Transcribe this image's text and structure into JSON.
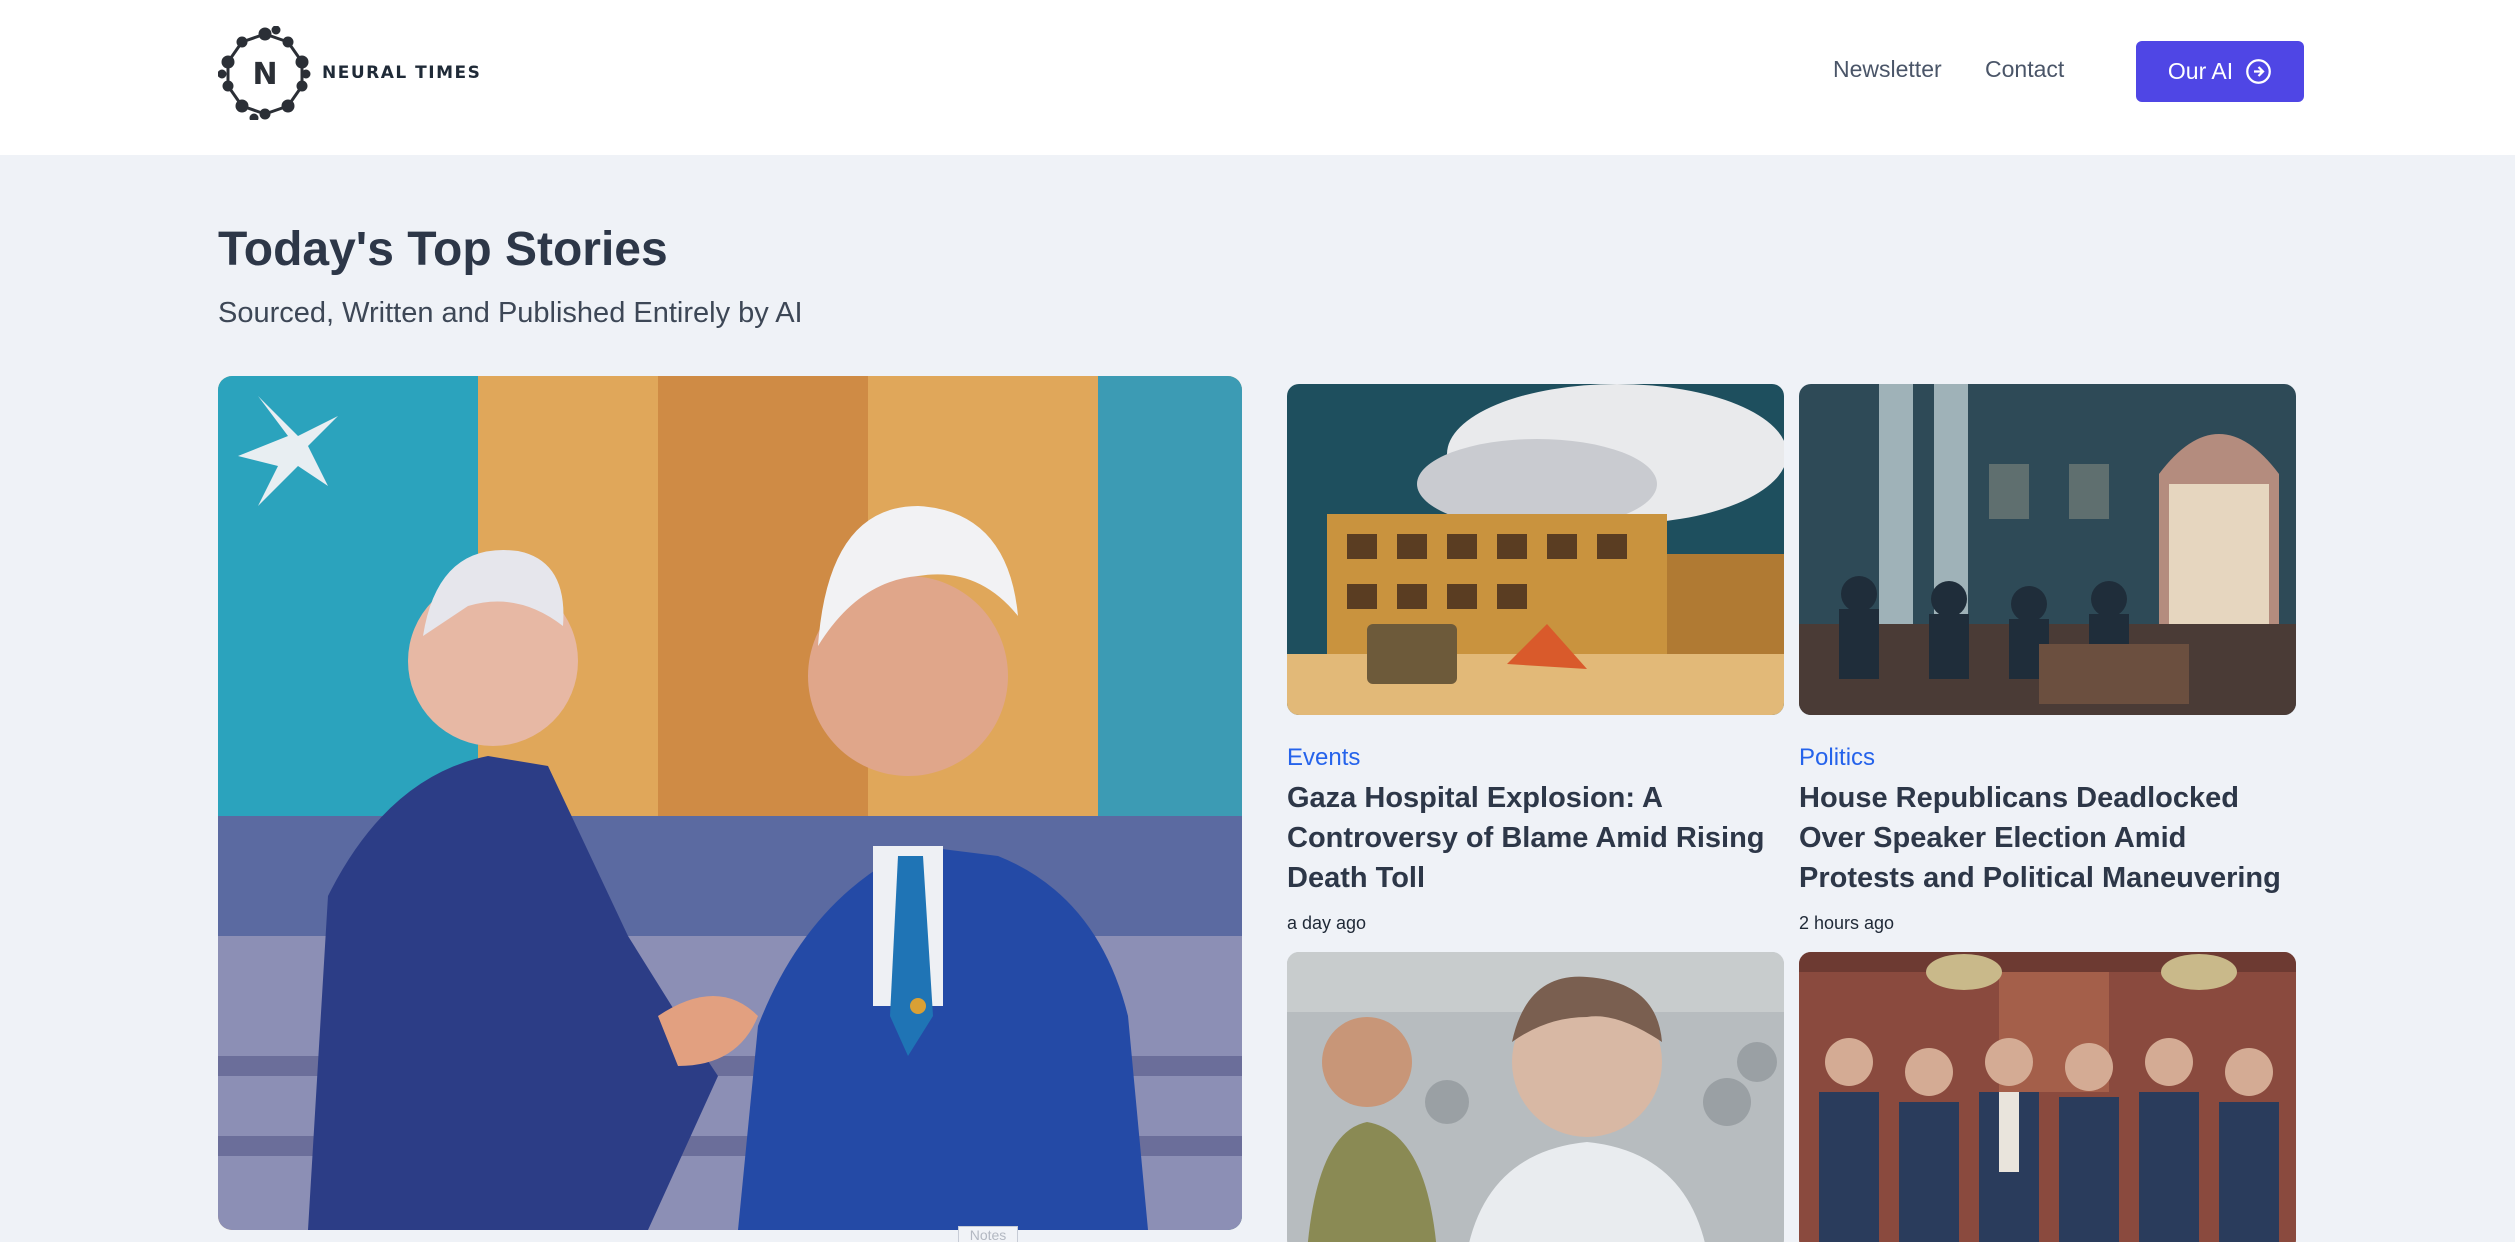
{
  "brand": {
    "name": "NEURAL TIMES",
    "mark_letter": "N"
  },
  "nav": {
    "links": [
      "Newsletter",
      "Contact"
    ],
    "cta_label": "Our AI",
    "cta_icon": "arrow-circle-right-icon"
  },
  "page": {
    "title": "Today's Top Stories",
    "subtitle": "Sourced, Written and Published Entirely by AI"
  },
  "hero": {
    "image_alt": "Illustration of two men in suits shaking hands in front of a crowd",
    "notes_label": "Notes"
  },
  "articles": [
    {
      "category": "Events",
      "title": "Gaza Hospital Explosion: A Controversy of Blame Amid Rising Death Toll",
      "time": "a day ago",
      "image_alt": "Illustration of a damaged building with smoke"
    },
    {
      "category": "Politics",
      "title": "House Republicans Deadlocked Over Speaker Election Amid Protests and Political Maneuvering",
      "time": "2 hours ago",
      "image_alt": "Illustration of men in suits in an ornate chamber"
    },
    {
      "image_alt": "Illustration of two men in a crowd"
    },
    {
      "image_alt": "Illustration of a crowd of men in suits in a hall"
    }
  ],
  "colors": {
    "accent": "#4f46e5",
    "category": "#2563eb",
    "page_bg": "#eff2f7"
  }
}
